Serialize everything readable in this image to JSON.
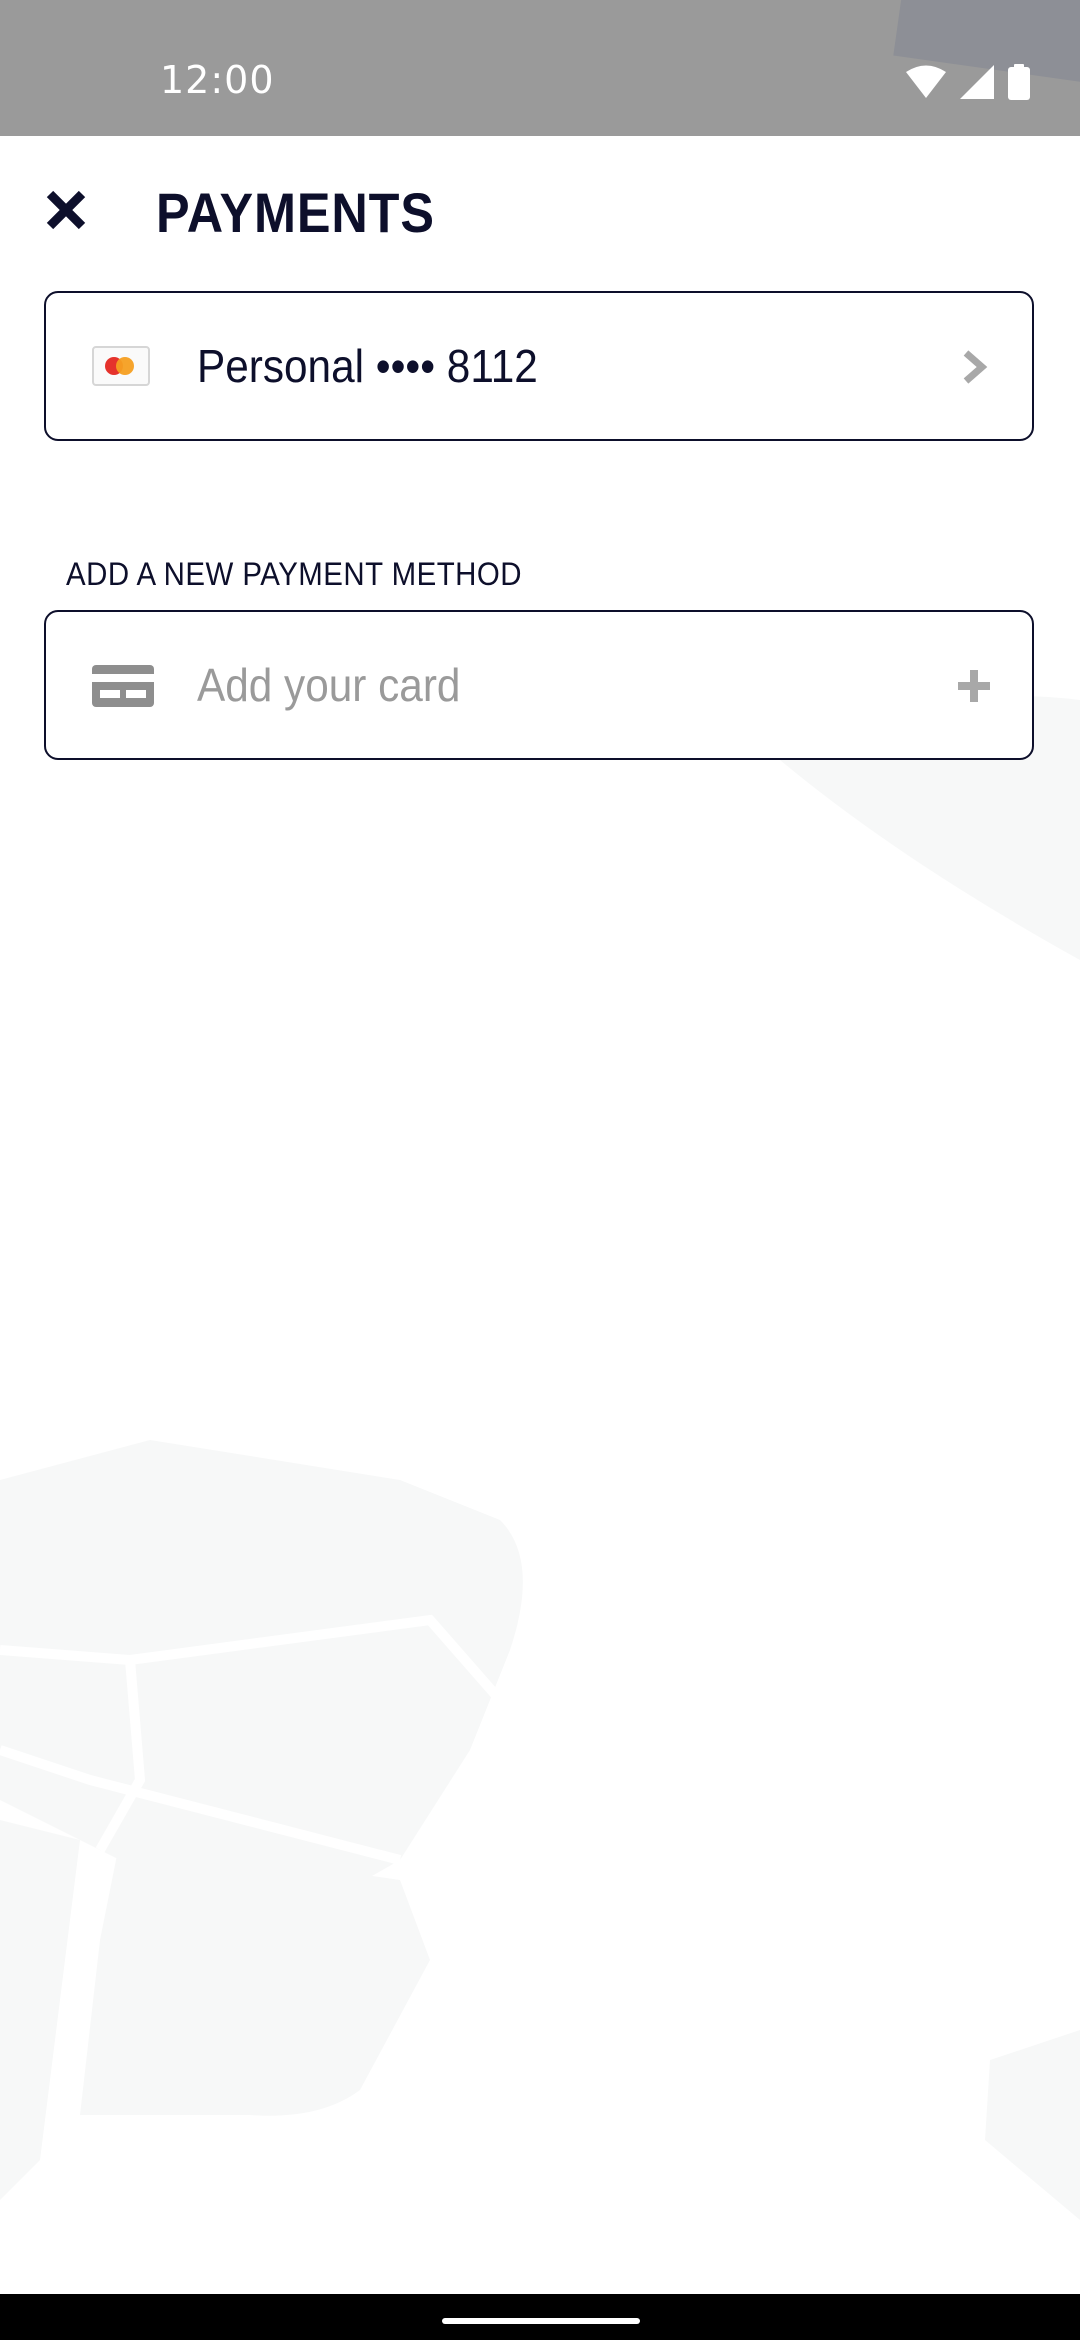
{
  "status_bar": {
    "time": "12:00"
  },
  "header": {
    "title": "PAYMENTS",
    "close_icon": "close-icon"
  },
  "saved_payment": {
    "label": "Personal •••• 8112",
    "brand_icon": "mastercard-icon",
    "action_icon": "chevron-right-icon"
  },
  "add_method": {
    "section_title": "ADD A NEW PAYMENT METHOD",
    "placeholder": "Add your card",
    "icon": "credit-card-icon",
    "action_icon": "plus-icon"
  },
  "colors": {
    "primary_text": "#0d0f2b",
    "muted_text": "#9a9a9a",
    "status_bar": "#9a9a9a",
    "card_border": "#0d0f2b"
  }
}
